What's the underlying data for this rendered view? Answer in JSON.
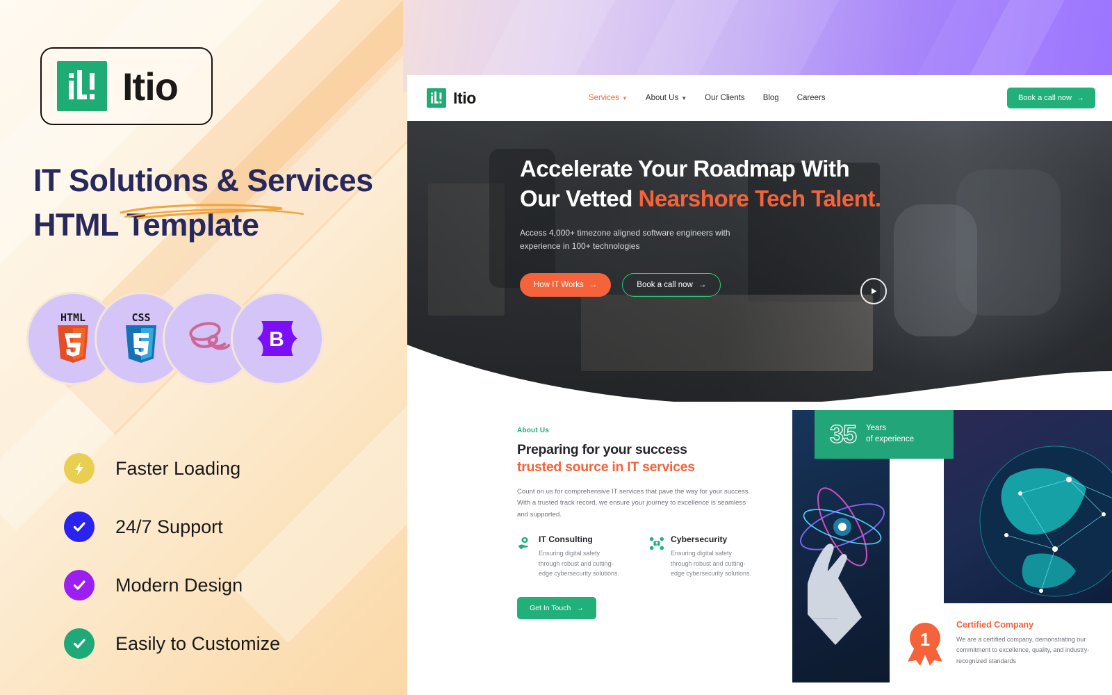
{
  "promo": {
    "logo": {
      "mark_text": "it!",
      "word": "Itio"
    },
    "title_line1": "IT Solutions & Services",
    "title_line2": "HTML Template",
    "tech_badges": [
      {
        "name": "html5-badge",
        "label": "HTML",
        "digit": "5"
      },
      {
        "name": "css3-badge",
        "label": "CSS",
        "digit": "3"
      },
      {
        "name": "sass-badge",
        "label": "Sass",
        "digit": ""
      },
      {
        "name": "bootstrap-badge",
        "label": "B",
        "digit": ""
      }
    ],
    "features": [
      {
        "label": "Faster Loading",
        "icon": "lightning-icon",
        "color": "#e8cf4f"
      },
      {
        "label": "24/7 Support",
        "icon": "check-icon",
        "color": "#2a22ee"
      },
      {
        "label": "Modern Design",
        "icon": "check-icon",
        "color": "#9b1ff0"
      },
      {
        "label": "Easily to Customize",
        "icon": "check-icon",
        "color": "#1fa978"
      }
    ]
  },
  "site": {
    "nav": {
      "logo_mark": "it!",
      "logo_word": "Itio",
      "links": [
        {
          "label": "Services",
          "has_caret": true,
          "active": true
        },
        {
          "label": "About Us",
          "has_caret": true,
          "active": false
        },
        {
          "label": "Our Clients",
          "has_caret": false,
          "active": false
        },
        {
          "label": "Blog",
          "has_caret": false,
          "active": false
        },
        {
          "label": "Careers",
          "has_caret": false,
          "active": false
        }
      ],
      "cta": "Book a call now"
    },
    "hero": {
      "title_part1": "Accelerate Your Roadmap With Our Vetted ",
      "title_accent": "Nearshore Tech Talent.",
      "subtitle": "Access 4,000+ timezone aligned software engineers with experience in 100+ technologies",
      "btn_primary": "How IT Works",
      "btn_secondary": "Book a call now",
      "play_label": "play-video"
    },
    "about": {
      "eyebrow": "About Us",
      "heading_line1": "Preparing for your success",
      "heading_line2": "trusted source in IT services",
      "body": "Count on us for comprehensive IT services that pave the way for your success. With a trusted track record, we ensure your journey to excellence is seamless and supported.",
      "services": [
        {
          "title": "IT Consulting",
          "text": "Ensuring digital safety through robust and cutting-edge cybersecurity solutions.",
          "icon": "hand-leaf-icon"
        },
        {
          "title": "Cybersecurity",
          "text": "Ensuring digital safety through robust and cutting-edge cybersecurity solutions.",
          "icon": "network-user-icon"
        }
      ],
      "cta": "Get In Touch"
    },
    "stats": {
      "years_number": "35",
      "years_line1": "Years",
      "years_line2": "of experience"
    },
    "certified": {
      "title": "Certified Company",
      "text": "We are a certified company, demonstrating our commitment to excellence, quality, and industry-recognized standards",
      "badge_number": "1"
    }
  },
  "colors": {
    "green": "#22b07a",
    "orange": "#f4633a",
    "navy": "#27285c",
    "amber": "#f2a33c",
    "purple": "#9b74ff"
  }
}
